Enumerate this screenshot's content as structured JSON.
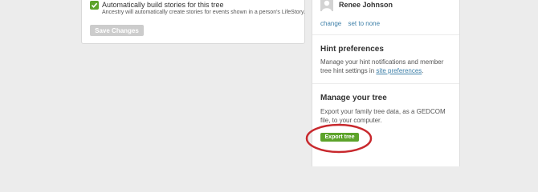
{
  "stories": {
    "auto_build_label": "Automatically build stories for this tree",
    "auto_build_help": "Ancestry will automatically create stories for events shown in a person's LifeStory.",
    "auto_build_checked": true,
    "save_label": "Save Changes"
  },
  "sidebar": {
    "person_name": "Renee Johnson",
    "change_link": "change",
    "set_none_link": "set to none",
    "hint": {
      "title": "Hint preferences",
      "text_before": "Manage your hint notifications and member tree hint settings in ",
      "link": "site preferences",
      "text_after": "."
    },
    "manage": {
      "title": "Manage your tree",
      "text": "Export your family tree data, as a GEDCOM file, to your computer.",
      "export_label": "Export tree"
    }
  },
  "colors": {
    "accent_green": "#5ca32a",
    "link_blue": "#3d7fa8",
    "highlight_red": "#c8282d",
    "background": "#ececec"
  }
}
